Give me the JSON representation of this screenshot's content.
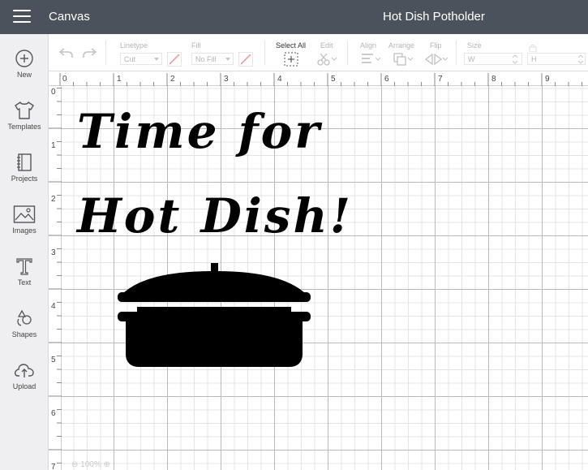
{
  "header": {
    "app_title": "Canvas",
    "project_title": "Hot Dish Potholder"
  },
  "toolbar": {
    "linetype": {
      "label": "Linetype",
      "value": "Cut"
    },
    "fill": {
      "label": "Fill",
      "value": "No Fill"
    },
    "select_all": "Select All",
    "edit": "Edit",
    "align": "Align",
    "arrange": "Arrange",
    "flip": "Flip",
    "size": {
      "label": "Size",
      "w": "W",
      "h": "H"
    }
  },
  "sidebar": {
    "items": [
      {
        "label": "New",
        "icon": "plus-circle-icon"
      },
      {
        "label": "Templates",
        "icon": "shirt-icon"
      },
      {
        "label": "Projects",
        "icon": "notebook-icon"
      },
      {
        "label": "Images",
        "icon": "image-icon"
      },
      {
        "label": "Text",
        "icon": "text-t-icon"
      },
      {
        "label": "Shapes",
        "icon": "shapes-icon"
      },
      {
        "label": "Upload",
        "icon": "cloud-upload-icon"
      }
    ]
  },
  "rulers": {
    "horizontal": [
      "0",
      "1",
      "2",
      "3",
      "4",
      "5",
      "6",
      "7",
      "8",
      "9"
    ],
    "vertical": [
      "0",
      "1",
      "2",
      "3",
      "4",
      "5",
      "6",
      "7"
    ]
  },
  "design": {
    "line1": "Time for",
    "line2": "Hot Dish!",
    "image_icon": "casserole-dish-icon",
    "color": "#000000"
  },
  "zoom": {
    "value": "100%"
  },
  "colors": {
    "topbar": "#4a535b",
    "sidebar": "#efeff1",
    "disabled": "#b5b5b5"
  }
}
